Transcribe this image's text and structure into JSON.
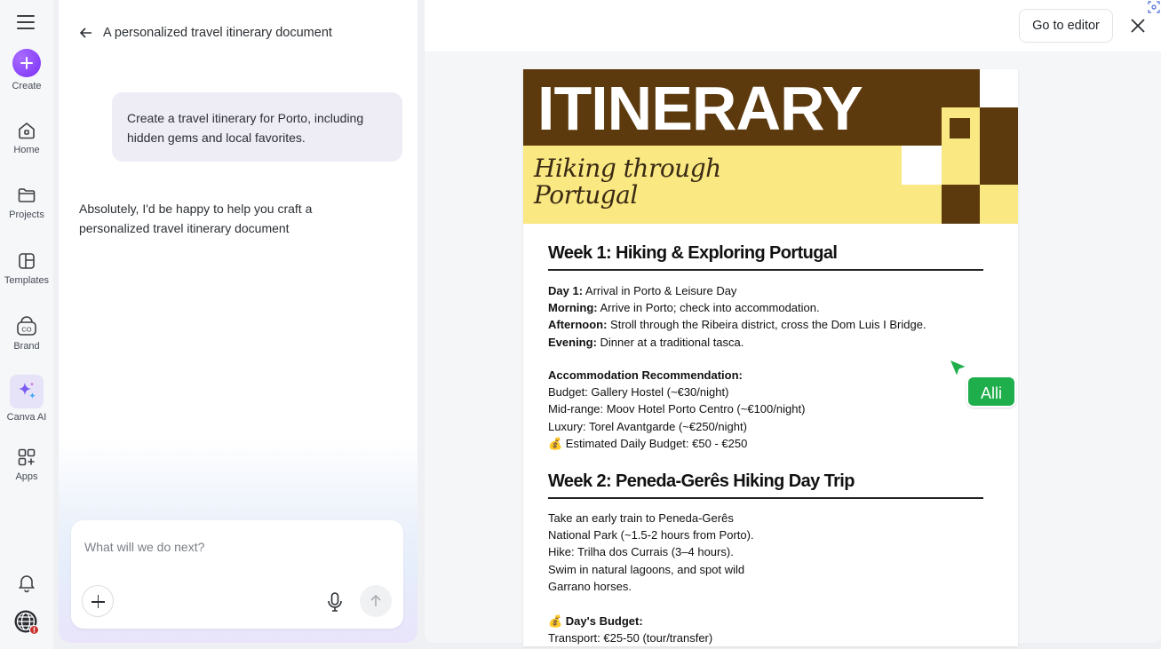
{
  "rail": {
    "items": [
      {
        "label": "Create"
      },
      {
        "label": "Home"
      },
      {
        "label": "Projects"
      },
      {
        "label": "Templates"
      },
      {
        "label": "Brand"
      },
      {
        "label": "Canva AI"
      },
      {
        "label": "Apps"
      }
    ]
  },
  "chat": {
    "title": "A personalized travel itinerary document",
    "user_message": "Create a travel itinerary for Porto, including hidden gems and local favorites.",
    "ai_message": "Absolutely, I'd be happy to help you craft a personalized travel itinerary document",
    "composer_placeholder": "What will we do next?"
  },
  "preview": {
    "go_editor_label": "Go to editor"
  },
  "document": {
    "banner_title": "ITINERARY",
    "banner_subtitle_line1": "Hiking through",
    "banner_subtitle_line2": "Portugal",
    "week1_heading": "Week 1: Hiking & Exploring Portugal",
    "week1": {
      "day_label": "Day 1:",
      "day_text": " Arrival in Porto & Leisure Day",
      "morning_label": "Morning:",
      "morning_text": " Arrive in Porto; check into accommodation.",
      "afternoon_label": "Afternoon:",
      "afternoon_text": " Stroll through the Ribeira district, cross the Dom Luis I Bridge.",
      "evening_label": "Evening:",
      "evening_text": " Dinner at a traditional tasca.",
      "accom_label": "Accommodation Recommendation:",
      "budget": "Budget: Gallery Hostel (~€30/night)",
      "midrange": "Mid-range: Moov Hotel Porto Centro (~€100/night)",
      "luxury": "Luxury: Torel Avantgarde (~€250/night)",
      "daily_budget": "💰 Estimated Daily Budget: €50 - €250"
    },
    "week2_heading": "Week 2: Peneda-Gerês Hiking Day Trip",
    "week2": {
      "line1": "Take an early train to Peneda-Gerês",
      "line2": "National Park (~1.5-2 hours from Porto).",
      "line3": "Hike: Trilha dos Currais (3–4 hours).",
      "line4": "Swim in natural lagoons, and spot wild",
      "line5": "Garrano horses.",
      "budget_label": "💰 Day's Budget:",
      "transport": "Transport: €25-50 (tour/transfer)"
    }
  },
  "collaborator": {
    "name": "Alli",
    "color": "#1eae4b"
  },
  "colors": {
    "accent": "#7b2ff7",
    "banner_brown": "#5c3a0e",
    "banner_yellow": "#fae882"
  }
}
